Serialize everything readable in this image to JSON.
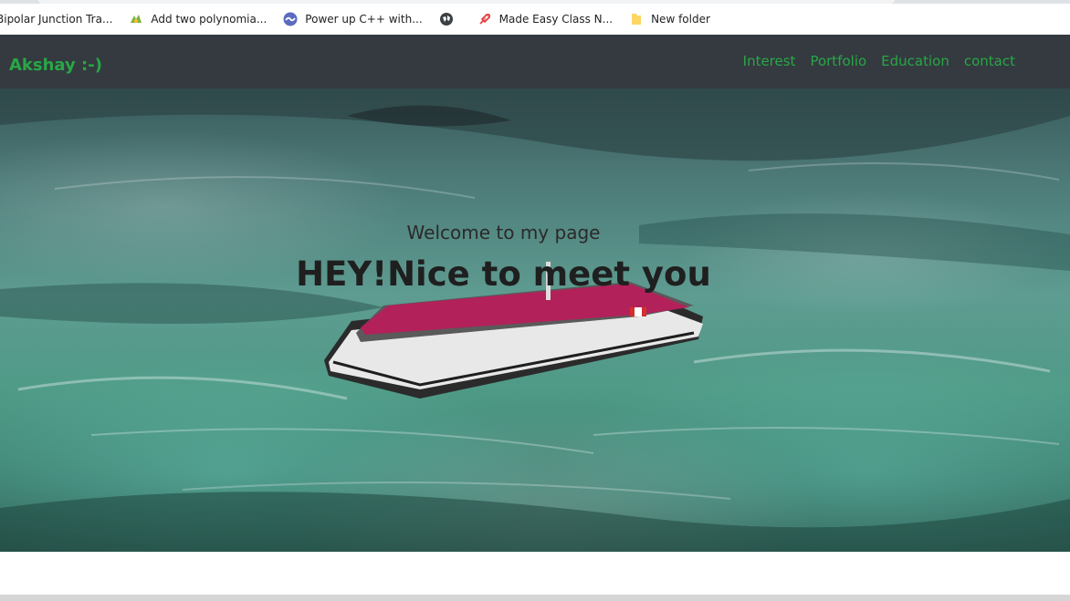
{
  "bookmarks": [
    {
      "label": "Bipolar Junction Tra...",
      "icon": "bookmark-page-icon"
    },
    {
      "label": "Add two polynomia...",
      "icon": "green-bird-icon"
    },
    {
      "label": "Power up C++ with...",
      "icon": "blue-wave-icon"
    },
    {
      "label": "",
      "icon": "globe-icon"
    },
    {
      "label": "Made Easy Class N...",
      "icon": "rocket-icon"
    },
    {
      "label": "New folder",
      "icon": "folder-icon"
    }
  ],
  "navbar": {
    "brand": "Akshay :-)",
    "links": [
      "Interest",
      "Portfolio",
      "Education",
      "contact"
    ]
  },
  "hero": {
    "welcome": "Welcome to my page",
    "headline": "HEY!Nice to meet you"
  },
  "colors": {
    "navbar_bg": "#343a40",
    "accent_green": "#28a745",
    "text_dark": "#1f1f1f"
  }
}
